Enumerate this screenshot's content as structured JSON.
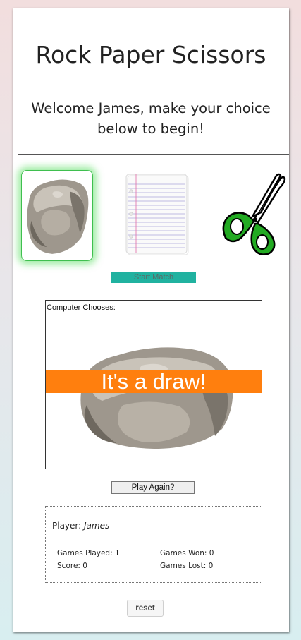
{
  "header": {
    "title": "Rock Paper Scissors",
    "welcome": "Welcome James, make your choice below to begin!"
  },
  "choices": [
    {
      "name": "rock",
      "icon": "rock-image",
      "selected": true
    },
    {
      "name": "paper",
      "icon": "notebook-paper-image",
      "selected": false
    },
    {
      "name": "scissors",
      "icon": "scissors-image",
      "selected": false
    }
  ],
  "controls": {
    "start_label": "Start Match",
    "play_again_label": "Play Again?",
    "reset_label": "reset"
  },
  "computer": {
    "label": "Computer Chooses:",
    "choice_icon": "rock-image",
    "result": "It's a draw!"
  },
  "stats": {
    "player_prefix": "Player: ",
    "player_name": "James",
    "games_played": "Games Played: 1",
    "games_won": "Games Won: 0",
    "score": "Score: 0",
    "games_lost": "Games Lost: 0"
  },
  "colors": {
    "start_button": "#20b2a0",
    "result_banner": "#ff7f0e",
    "selected_glow": "#3fbf4f",
    "scissors_handle": "#22aa22"
  }
}
